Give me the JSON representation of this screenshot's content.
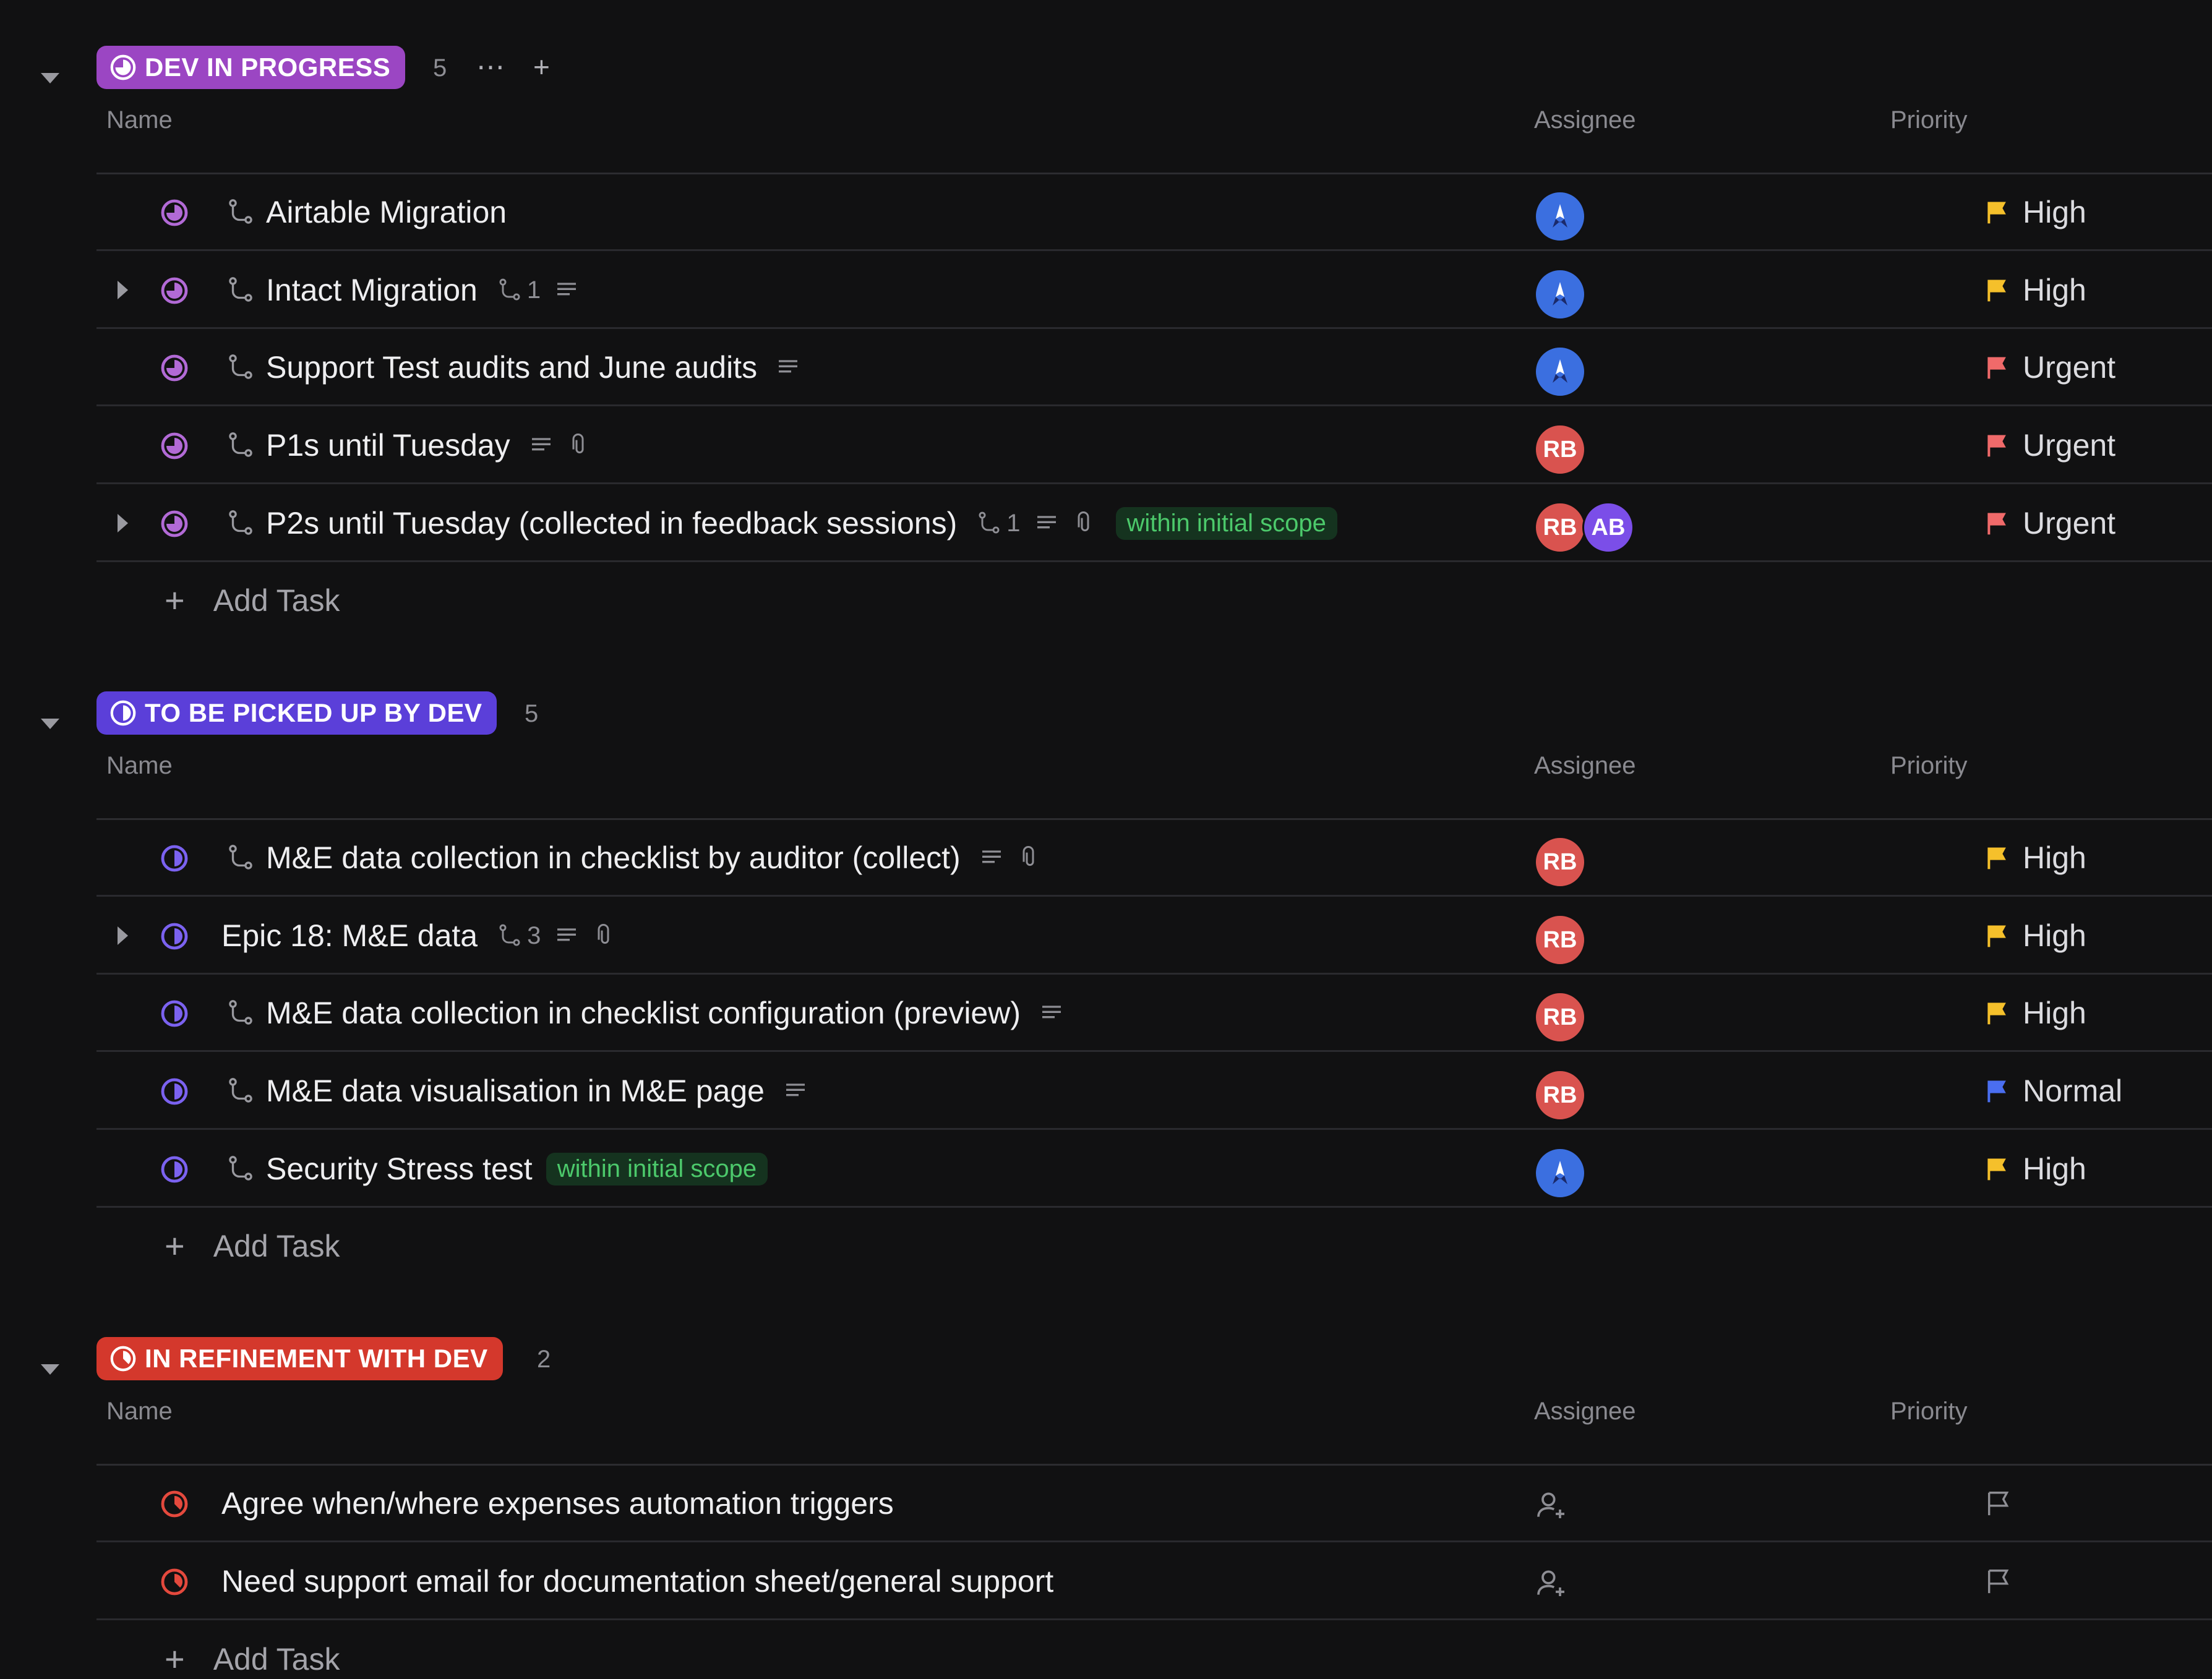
{
  "columns": {
    "name": "Name",
    "assignee": "Assignee",
    "priority": "Priority"
  },
  "add_task_label": "Add Task",
  "colors": {
    "dev_in_progress": "#9b46c3",
    "to_be_picked_up": "#5b3fd9",
    "in_refinement": "#d4382c",
    "priority_high": "#f5c02b",
    "priority_urgent": "#f06a6a",
    "priority_normal": "#4a6ef0"
  },
  "groups": [
    {
      "status": "DEV IN PROGRESS",
      "count": "5",
      "tasks": [
        {
          "name": "Airtable Migration",
          "subtasks": null,
          "has_desc": false,
          "has_attach": false,
          "tag": null,
          "assignees": [
            "rocket"
          ],
          "priority": "High"
        },
        {
          "name": "Intact Migration",
          "subtasks": "1",
          "has_desc": true,
          "has_attach": false,
          "tag": null,
          "assignees": [
            "rocket"
          ],
          "priority": "High"
        },
        {
          "name": "Support Test audits and June audits",
          "subtasks": null,
          "has_desc": true,
          "has_attach": false,
          "tag": null,
          "assignees": [
            "rocket"
          ],
          "priority": "Urgent"
        },
        {
          "name": "P1s until Tuesday",
          "subtasks": null,
          "has_desc": true,
          "has_attach": true,
          "tag": null,
          "assignees": [
            "RB"
          ],
          "priority": "Urgent"
        },
        {
          "name": "P2s until Tuesday (collected in feedback sessions)",
          "subtasks": "1",
          "has_desc": true,
          "has_attach": true,
          "tag": "within initial scope",
          "assignees": [
            "RB",
            "AB"
          ],
          "priority": "Urgent"
        }
      ]
    },
    {
      "status": "TO BE PICKED UP BY DEV",
      "count": "5",
      "tasks": [
        {
          "name": "M&E data collection in checklist by auditor (collect)",
          "subtasks": null,
          "has_desc": true,
          "has_attach": true,
          "tag": null,
          "assignees": [
            "RB"
          ],
          "priority": "High"
        },
        {
          "name": "Epic 18: M&E data",
          "subtasks": "3",
          "has_desc": true,
          "has_attach": true,
          "tag": null,
          "assignees": [
            "RB"
          ],
          "priority": "High"
        },
        {
          "name": "M&E data collection in checklist configuration (preview)",
          "subtasks": null,
          "has_desc": true,
          "has_attach": false,
          "tag": null,
          "assignees": [
            "RB"
          ],
          "priority": "High"
        },
        {
          "name": "M&E data visualisation in M&E page",
          "subtasks": null,
          "has_desc": true,
          "has_attach": false,
          "tag": null,
          "assignees": [
            "RB"
          ],
          "priority": "Normal"
        },
        {
          "name": "Security Stress test",
          "subtasks": null,
          "has_desc": false,
          "has_attach": false,
          "tag": "within initial scope",
          "assignees": [
            "rocket"
          ],
          "priority": "High"
        }
      ]
    },
    {
      "status": "IN REFINEMENT WITH DEV",
      "count": "2",
      "tasks": [
        {
          "name": "Agree when/where expenses automation triggers",
          "priority": null
        },
        {
          "name": "Need support email for documentation sheet/general support",
          "priority": null
        }
      ]
    }
  ]
}
